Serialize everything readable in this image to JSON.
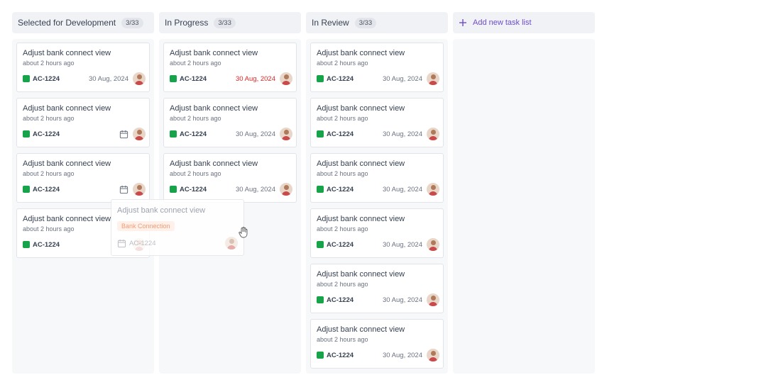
{
  "columns": [
    {
      "title": "Selected for Development",
      "count": "3/33",
      "cards": [
        {
          "title": "Adjust bank connect view",
          "time": "about 2 hours ago",
          "code": "AC-1224",
          "date": "30 Aug, 2024",
          "overdue": false,
          "icon": null
        },
        {
          "title": "Adjust bank connect view",
          "time": "about 2 hours ago",
          "code": "AC-1224",
          "date": null,
          "overdue": false,
          "icon": "calendar-icon"
        },
        {
          "title": "Adjust bank connect view",
          "time": "about 2 hours ago",
          "code": "AC-1224",
          "date": null,
          "overdue": false,
          "icon": "calendar-icon"
        },
        {
          "title": "Adjust bank connect view",
          "time": "about 2 hours ago",
          "code": "AC-1224",
          "date": null,
          "overdue": false,
          "icon": null
        }
      ]
    },
    {
      "title": "In Progress",
      "count": "3/33",
      "cards": [
        {
          "title": "Adjust bank connect view",
          "time": "about 2 hours ago",
          "code": "AC-1224",
          "date": "30 Aug, 2024",
          "overdue": true,
          "icon": null
        },
        {
          "title": "Adjust bank connect view",
          "time": "about 2 hours ago",
          "code": "AC-1224",
          "date": "30 Aug, 2024",
          "overdue": false,
          "icon": null
        },
        {
          "title": "Adjust bank connect view",
          "time": "about 2 hours ago",
          "code": "AC-1224",
          "date": "30 Aug, 2024",
          "overdue": false,
          "icon": null
        }
      ]
    },
    {
      "title": "In Review",
      "count": "3/33",
      "cards": [
        {
          "title": "Adjust bank connect view",
          "time": "about 2 hours ago",
          "code": "AC-1224",
          "date": "30 Aug, 2024",
          "overdue": false,
          "icon": null
        },
        {
          "title": "Adjust bank connect view",
          "time": "about 2 hours ago",
          "code": "AC-1224",
          "date": "30 Aug, 2024",
          "overdue": false,
          "icon": null
        },
        {
          "title": "Adjust bank connect view",
          "time": "about 2 hours ago",
          "code": "AC-1224",
          "date": "30 Aug, 2024",
          "overdue": false,
          "icon": null
        },
        {
          "title": "Adjust bank connect view",
          "time": "about 2 hours ago",
          "code": "AC-1224",
          "date": "30 Aug, 2024",
          "overdue": false,
          "icon": null
        },
        {
          "title": "Adjust bank connect view",
          "time": "about 2 hours ago",
          "code": "AC-1224",
          "date": "30 Aug, 2024",
          "overdue": false,
          "icon": null
        },
        {
          "title": "Adjust bank connect view",
          "time": "about 2 hours ago",
          "code": "AC-1224",
          "date": "30 Aug, 2024",
          "overdue": false,
          "icon": null
        }
      ]
    }
  ],
  "add_list": {
    "label": "Add new task list",
    "icon": "plus-icon"
  },
  "dragging_card": {
    "title": "Adjust bank connect view",
    "label": "Bank Connection",
    "code": "AC-1224",
    "icon": "calendar-icon"
  },
  "cursor": {
    "icon": "grab-hand-cursor-icon"
  },
  "colors": {
    "tag": "#16a34a",
    "overdue": "#dc2626",
    "accent": "#6d4bd1",
    "label_text": "#f29b74",
    "label_bg": "#fff1ea"
  }
}
